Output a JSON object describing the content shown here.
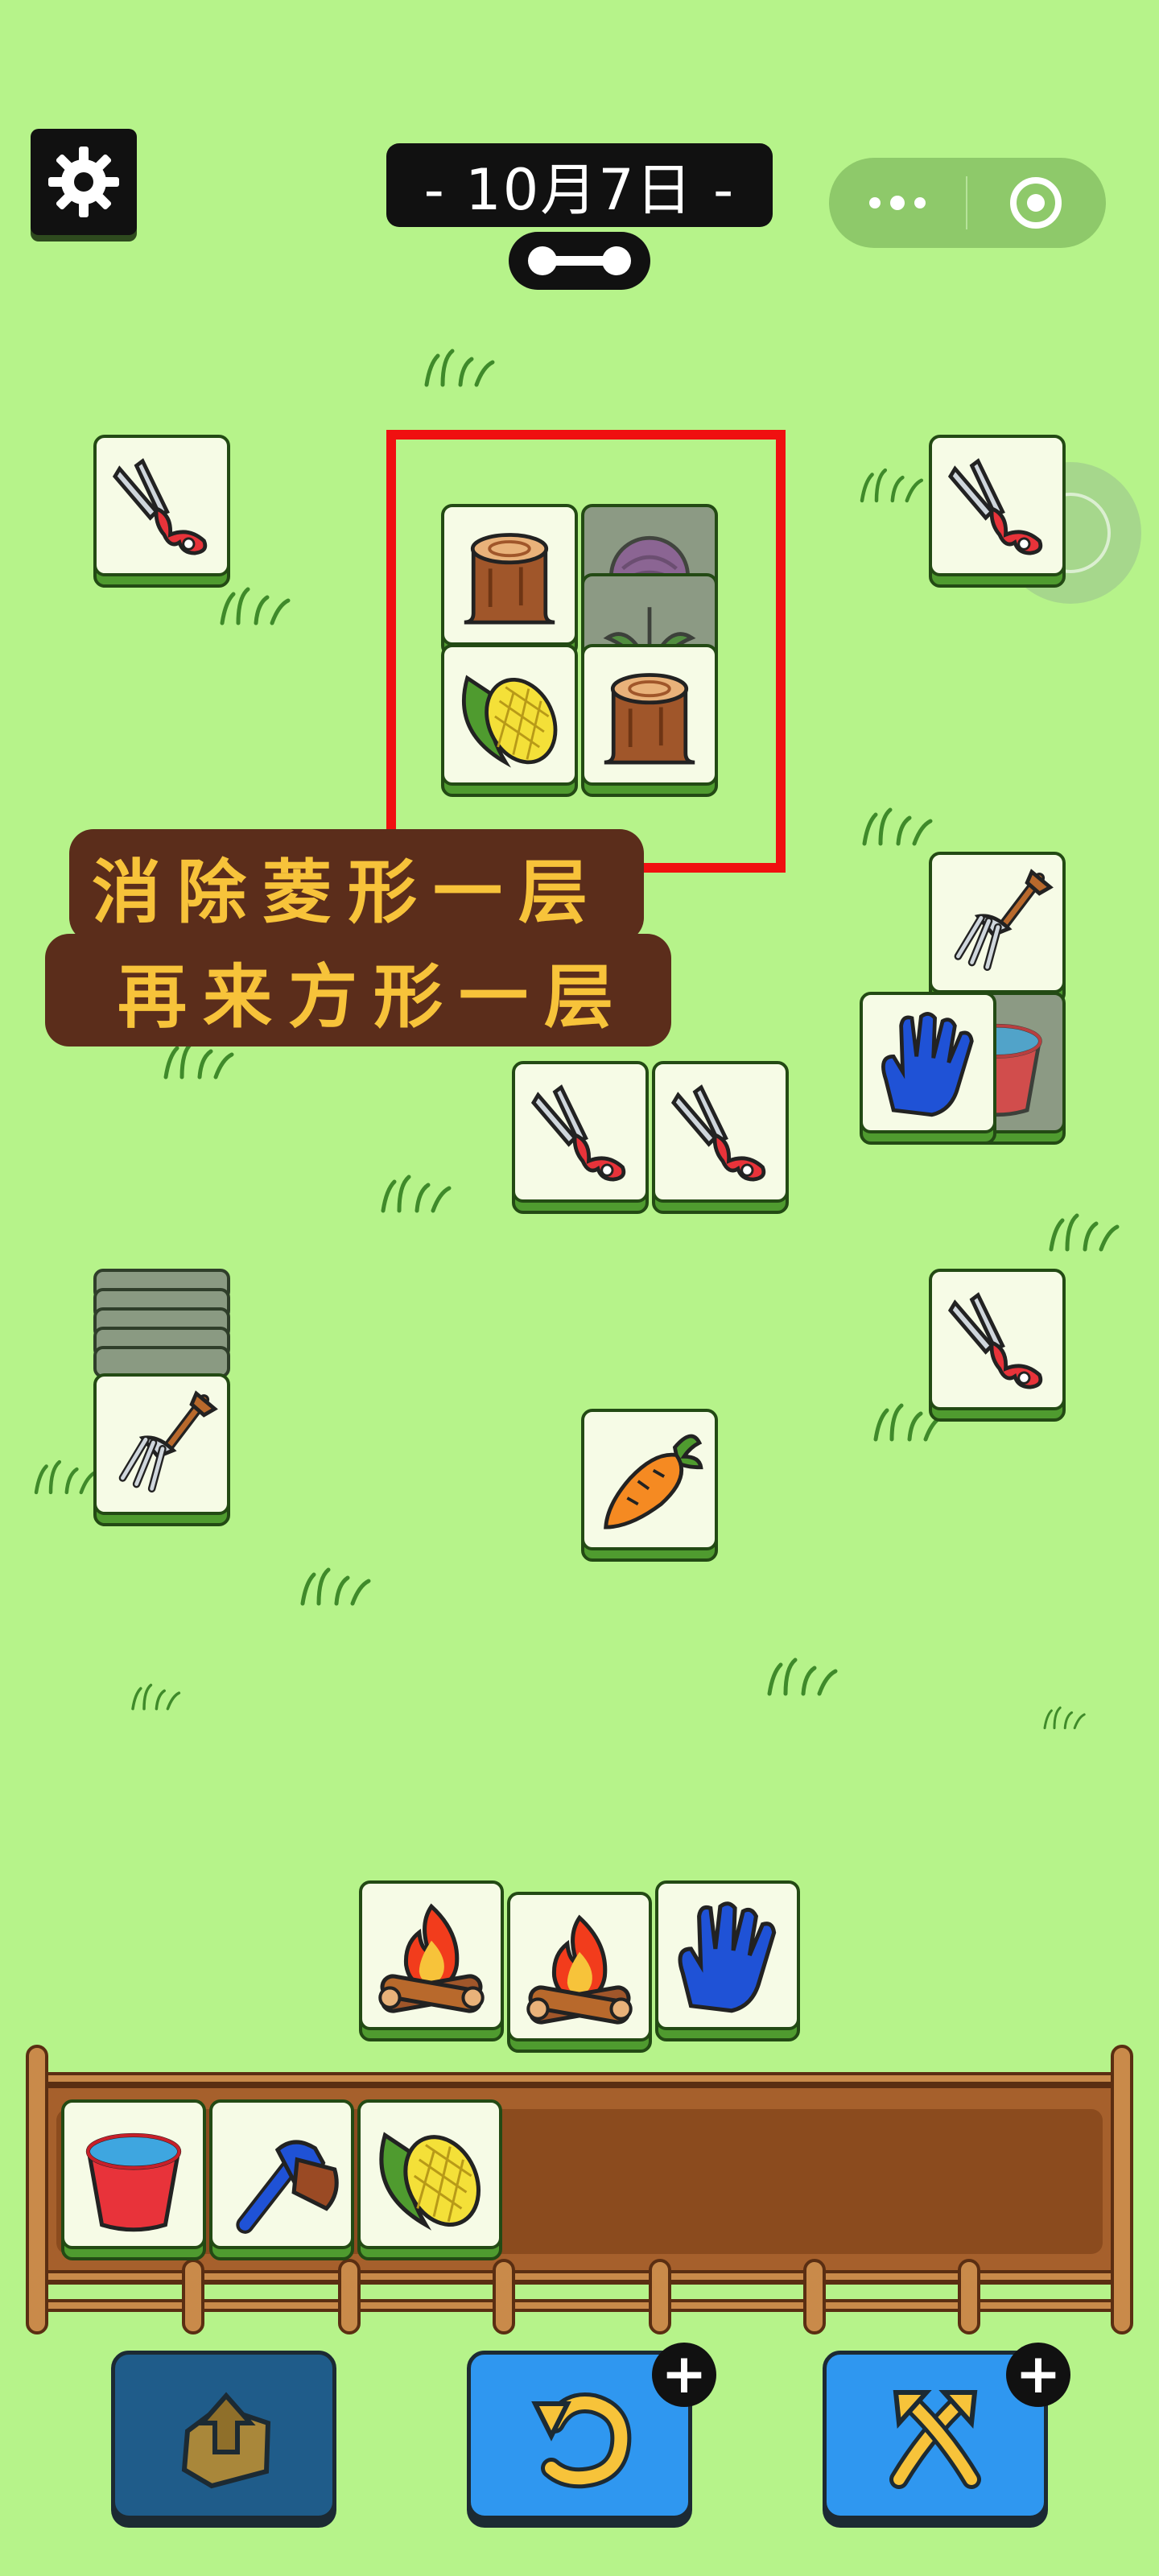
{
  "header": {
    "date_label": "- 10月7日 -",
    "settings_icon": "gear-icon",
    "progress_icon": "level-progress-icon",
    "capsule": {
      "more_icon": "more-dots-icon",
      "close_icon": "target-circle-icon"
    }
  },
  "caption": {
    "line1": "消除菱形一层",
    "line2": "再来方形一层"
  },
  "board": {
    "tiles": [
      {
        "item": "shears",
        "icon": "shears-icon"
      },
      {
        "item": "shears",
        "icon": "shears-icon"
      },
      {
        "item": "stump",
        "icon": "stump-icon"
      },
      {
        "item": "cabbage",
        "icon": "cabbage-icon",
        "covered": true
      },
      {
        "item": "sprout",
        "icon": "sprout-icon",
        "covered": true
      },
      {
        "item": "corn",
        "icon": "corn-icon"
      },
      {
        "item": "stump",
        "icon": "stump-icon"
      },
      {
        "item": "rake",
        "icon": "rake-icon"
      },
      {
        "item": "bucket",
        "icon": "bucket-icon",
        "covered": true
      },
      {
        "item": "glove",
        "icon": "glove-icon"
      },
      {
        "item": "shears",
        "icon": "shears-icon"
      },
      {
        "item": "shears",
        "icon": "shears-icon"
      },
      {
        "item": "rake",
        "icon": "rake-icon"
      },
      {
        "item": "shears",
        "icon": "shears-icon"
      },
      {
        "item": "carrot",
        "icon": "carrot-icon"
      },
      {
        "item": "campfire",
        "icon": "campfire-icon"
      },
      {
        "item": "campfire",
        "icon": "campfire-icon"
      },
      {
        "item": "glove",
        "icon": "glove-icon"
      }
    ]
  },
  "tray": {
    "slots": [
      {
        "item": "bucket",
        "icon": "bucket-icon"
      },
      {
        "item": "brush",
        "icon": "brush-icon"
      },
      {
        "item": "corn",
        "icon": "corn-icon"
      }
    ]
  },
  "buttons": {
    "move_out_icon": "move-out-icon",
    "undo_icon": "undo-icon",
    "shuffle_icon": "shuffle-icon",
    "plus_label": "+"
  },
  "colors": {
    "background": "#b6f38a",
    "highlight": "#f01010",
    "caption_bg": "#5b2d1b",
    "caption_text": "#f7c33a",
    "button_blue": "#2f97f0",
    "button_dark": "#1f5c8a"
  }
}
